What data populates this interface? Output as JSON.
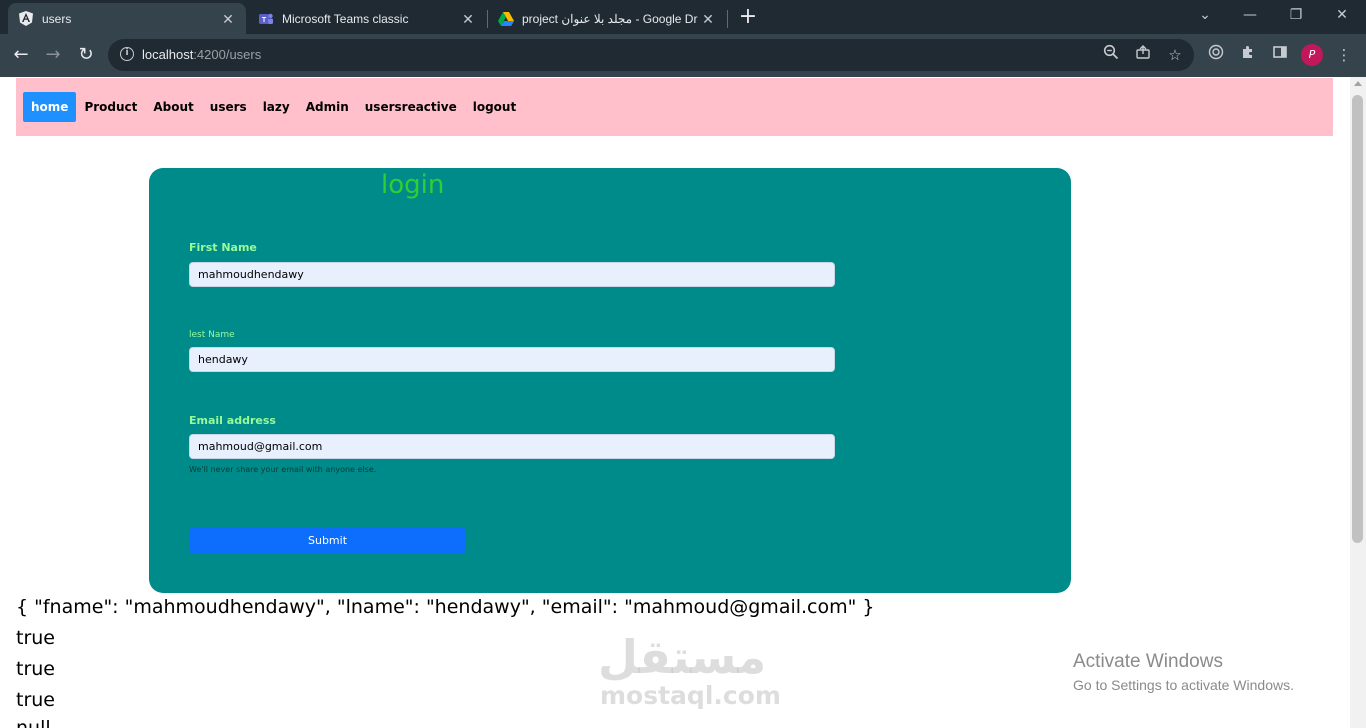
{
  "browser": {
    "tabs": [
      {
        "title": "users",
        "active": true
      },
      {
        "title": "Microsoft Teams classic",
        "active": false
      },
      {
        "title": "project مجلد بلا عنوان - Google Dr",
        "active": false
      }
    ],
    "url_host": "localhost",
    "url_path": ":4200/users"
  },
  "nav": {
    "items": [
      "home",
      "Product",
      "About",
      "users",
      "lazy",
      "Admin",
      "usersreactive",
      "logout"
    ],
    "active": "home"
  },
  "form": {
    "heading": "login",
    "first_name_label": "First Name",
    "first_name_value": "mahmoudhendawy",
    "last_name_label": "lest Name",
    "last_name_value": "hendawy",
    "email_label": "Email address",
    "email_value": "mahmoud@gmail.com",
    "email_help": "We'll never share your email with anyone else.",
    "submit_label": "Submit"
  },
  "output": {
    "json_line": "{ \"fname\": \"mahmoudhendawy\", \"lname\": \"hendawy\", \"email\": \"mahmoud@gmail.com\" }",
    "line1": "true",
    "line2": "true",
    "line3": "true",
    "line4": "null"
  },
  "watermark": {
    "arabic": "مستقل",
    "latin": "mostaql.com"
  },
  "activation": {
    "title": "Activate Windows",
    "subtitle": "Go to Settings to activate Windows."
  },
  "colors": {
    "nav_bg": "#ffc0cb",
    "nav_active": "#1e90ff",
    "card_bg": "#008b8b",
    "heading": "#32cd32",
    "label": "#98fb98",
    "submit": "#0d6efd"
  },
  "icons": [
    "angular-icon",
    "teams-icon",
    "google-drive-icon",
    "zoom-icon",
    "share-icon",
    "star-icon",
    "extension-icon",
    "puzzle-icon",
    "sidepanel-icon",
    "menu-icon"
  ]
}
